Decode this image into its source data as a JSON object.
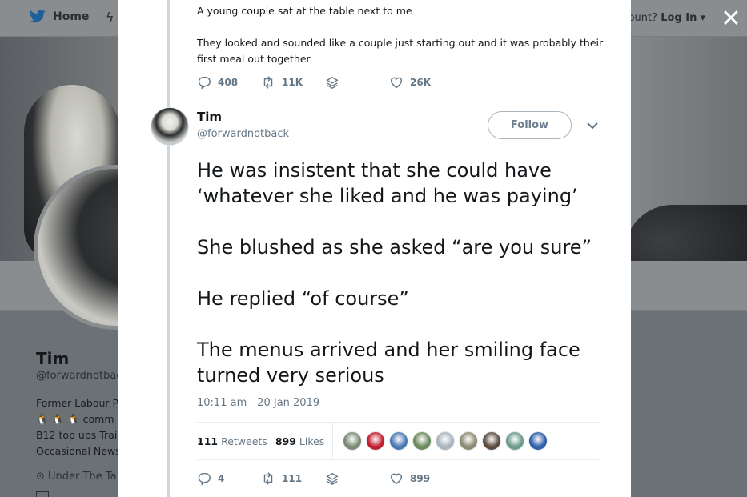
{
  "background": {
    "nav": {
      "home_label": "Home"
    },
    "login": {
      "prefix": "ccount?",
      "label": "Log In"
    },
    "profile": {
      "name": "Tim",
      "handle": "@forwardnotbac",
      "bio_lines": [
        "Former Labour P",
        "comm",
        "B12 top ups Trair",
        "Occasional News"
      ],
      "location": "Under The Ta"
    }
  },
  "previous_tweet": {
    "lines": [
      "A young couple sat at the table next to me",
      "They looked and sounded like a couple just starting out and it was probably their first meal out together"
    ],
    "replies": "408",
    "retweets": "11K",
    "likes": "26K"
  },
  "tweet": {
    "author_name": "Tim",
    "author_handle": "@forwardnotback",
    "follow_label": "Follow",
    "paragraphs": [
      "He was insistent that she could have ‘whatever she liked and he was paying’",
      "She blushed as she asked “are you sure”",
      "He replied “of course”",
      "The menus arrived and her smiling face turned very serious"
    ],
    "timestamp": "10:11 am - 20 Jan 2019",
    "retweet_count": "111",
    "retweet_label": "Retweets",
    "like_count": "899",
    "like_label": "Likes",
    "liker_colors": [
      "#7a8a74",
      "#c21d2e",
      "#4a78b5",
      "#6c8a5c",
      "#aab4bd",
      "#8d8b72",
      "#5c4a3d",
      "#6c9b8c",
      "#2f5fa8"
    ],
    "footer": {
      "replies": "4",
      "retweets": "111",
      "likes": "899"
    }
  }
}
